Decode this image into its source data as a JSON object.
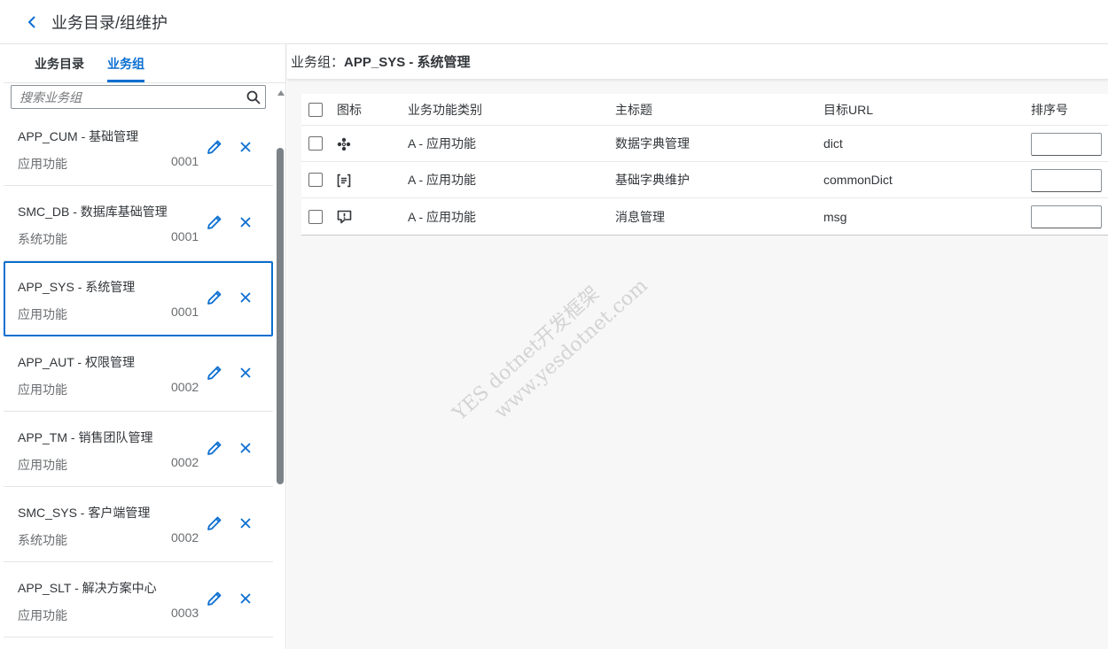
{
  "header": {
    "title": "业务目录/组维护"
  },
  "tabs": [
    {
      "label": "业务目录"
    },
    {
      "label": "业务组"
    }
  ],
  "search": {
    "placeholder": "搜索业务组"
  },
  "list": [
    {
      "title": "APP_CUM - 基础管理",
      "type": "应用功能",
      "num": "0001"
    },
    {
      "title": "SMC_DB - 数据库基础管理",
      "type": "系统功能",
      "num": "0001"
    },
    {
      "title": "APP_SYS - 系统管理",
      "type": "应用功能",
      "num": "0001"
    },
    {
      "title": "APP_AUT - 权限管理",
      "type": "应用功能",
      "num": "0002"
    },
    {
      "title": "APP_TM - 销售团队管理",
      "type": "应用功能",
      "num": "0002"
    },
    {
      "title": "SMC_SYS - 客户端管理",
      "type": "系统功能",
      "num": "0002"
    },
    {
      "title": "APP_SLT - 解决方案中心",
      "type": "应用功能",
      "num": "0003"
    }
  ],
  "group": {
    "label": "业务组：",
    "value": "APP_SYS - 系统管理"
  },
  "table": {
    "columns": {
      "icon": "图标",
      "category": "业务功能类别",
      "title": "主标题",
      "url": "目标URL",
      "sort": "排序号"
    },
    "rows": [
      {
        "icon": "cluster-icon",
        "category": "A - 应用功能",
        "title": "数据字典管理",
        "url": "dict"
      },
      {
        "icon": "list-bracket-icon",
        "category": "A - 应用功能",
        "title": "基础字典维护",
        "url": "commonDict"
      },
      {
        "icon": "message-alert-icon",
        "category": "A - 应用功能",
        "title": "消息管理",
        "url": "msg"
      }
    ]
  },
  "watermark": {
    "line1": "YES dotnet开发框架",
    "line2": "www.yesdotnet.com"
  },
  "colors": {
    "accent": "#0a6ed1",
    "text": "#32363a",
    "muted": "#6a6d70"
  }
}
